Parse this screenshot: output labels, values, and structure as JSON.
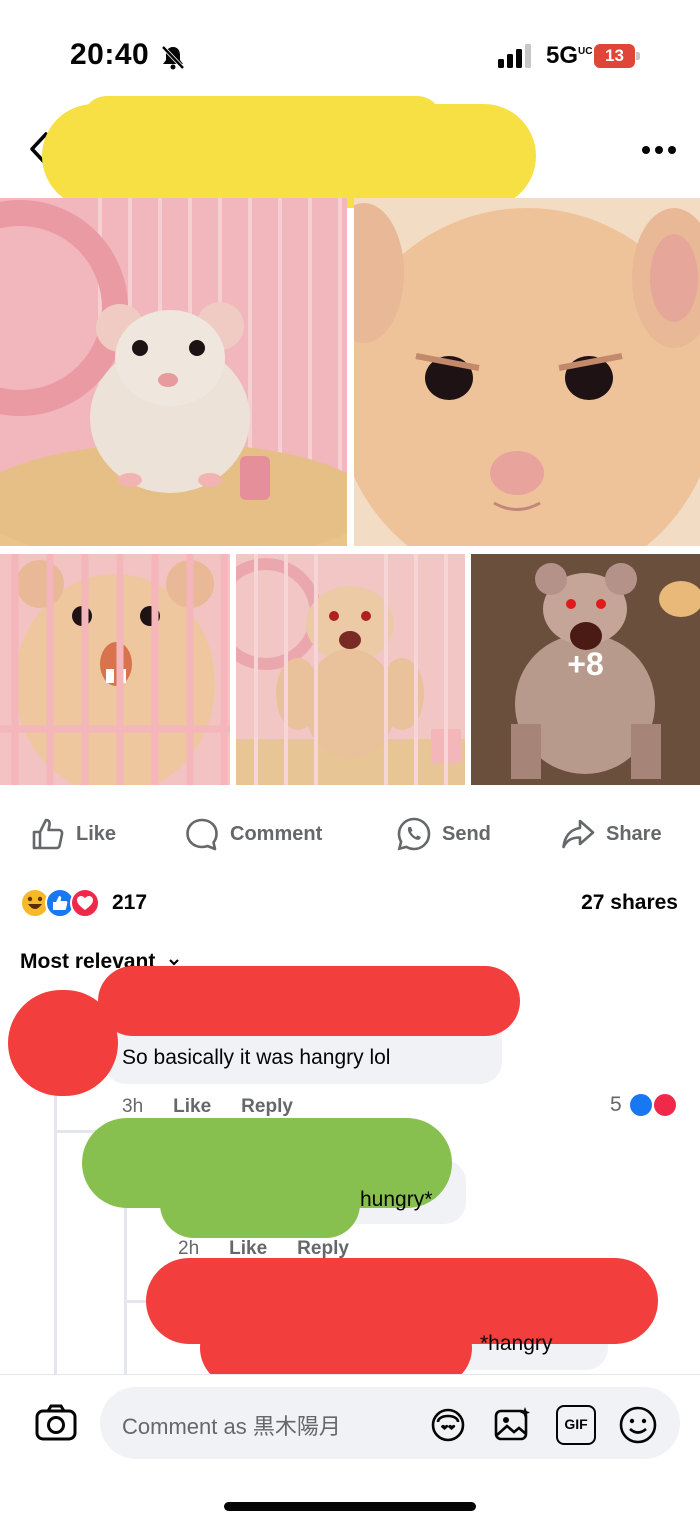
{
  "status": {
    "time": "20:40",
    "network": "5G",
    "network_sup": "UC",
    "battery": "13"
  },
  "photos": {
    "more_count": "+8"
  },
  "actions": {
    "like": "Like",
    "comment": "Comment",
    "send": "Send",
    "share": "Share"
  },
  "stats": {
    "reaction_count": "217",
    "shares": "27 shares"
  },
  "sort": {
    "label": "Most relevant"
  },
  "comments": [
    {
      "text": "So basically it was hangry lol",
      "time": "3h",
      "like": "Like",
      "reply": "Reply",
      "reaction_count": "5"
    },
    {
      "text": "hungry*",
      "time": "2h",
      "like": "Like",
      "reply": "Reply"
    },
    {
      "text": "*hangry"
    }
  ],
  "composer": {
    "placeholder": "Comment as 黒木陽月",
    "gif_label": "GIF"
  },
  "colors": {
    "like_blue": "#1877f2",
    "love_red": "#f02849",
    "haha_yellow": "#f7b928",
    "muted": "#65676b",
    "bubble": "#f0f2f5"
  }
}
